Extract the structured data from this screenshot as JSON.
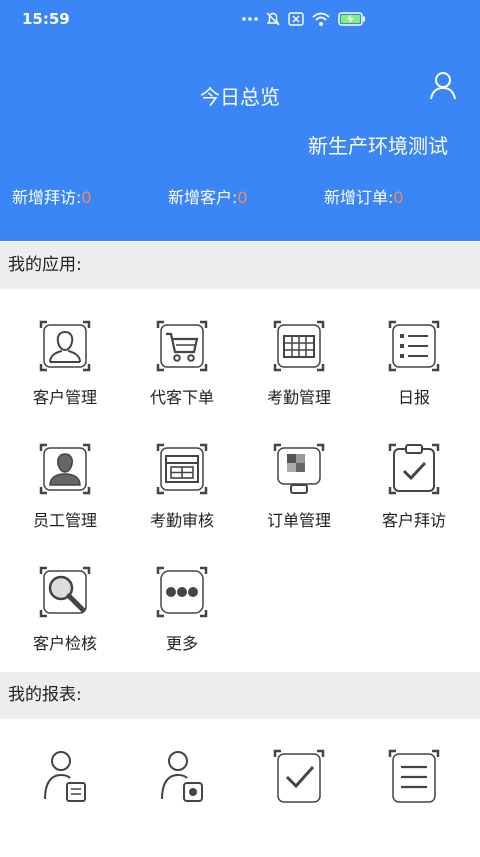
{
  "status_bar": {
    "time": "15:59"
  },
  "header": {
    "title": "今日总览",
    "env_label": "新生产环境测试",
    "stats": [
      {
        "label": "新增拜访:",
        "value": "0"
      },
      {
        "label": "新增客户:",
        "value": "0"
      },
      {
        "label": "新增订单:",
        "value": "0"
      }
    ]
  },
  "apps_section": {
    "title": "我的应用:",
    "items": [
      {
        "label": "客户管理",
        "icon": "customer-icon"
      },
      {
        "label": "代客下单",
        "icon": "cart-icon"
      },
      {
        "label": "考勤管理",
        "icon": "attendance-icon"
      },
      {
        "label": "日报",
        "icon": "daily-report-icon"
      },
      {
        "label": "员工管理",
        "icon": "employee-icon"
      },
      {
        "label": "考勤审核",
        "icon": "attendance-review-icon"
      },
      {
        "label": "订单管理",
        "icon": "order-icon"
      },
      {
        "label": "客户拜访",
        "icon": "clipboard-check-icon"
      },
      {
        "label": "客户检核",
        "icon": "magnifier-icon"
      },
      {
        "label": "更多",
        "icon": "more-icon"
      }
    ]
  },
  "reports_section": {
    "title": "我的报表:",
    "icons": [
      "user-report-icon",
      "user-camera-icon",
      "checkbox-report-icon",
      "list-report-icon"
    ]
  },
  "colors": {
    "header_bg": "#3b86f6",
    "stat_value": "#f08a5d",
    "section_bg": "#eeeeee",
    "icon_stroke": "#444444"
  }
}
